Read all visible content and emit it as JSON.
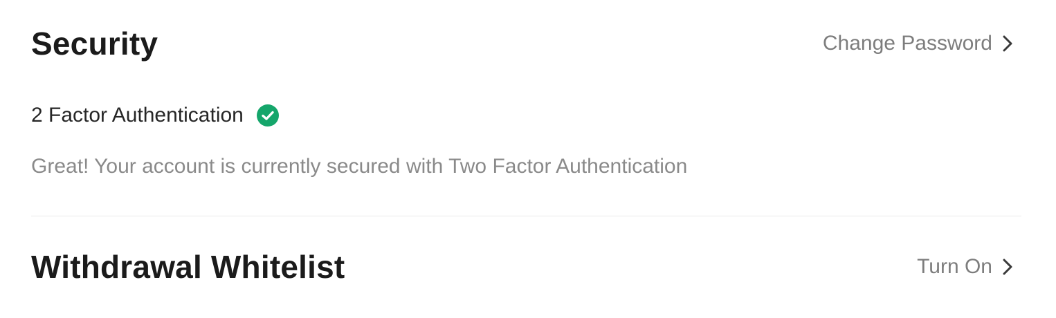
{
  "security": {
    "title": "Security",
    "change_password_label": "Change Password",
    "two_factor": {
      "label": "2 Factor Authentication",
      "status_icon": "check-circle-icon",
      "status_color": "#15a66b",
      "description": "Great! Your account is currently secured with Two Factor Authentication"
    }
  },
  "whitelist": {
    "title": "Withdrawal Whitelist",
    "action_label": "Turn On"
  },
  "colors": {
    "title": "#1b1b1b",
    "action": "#7d7d7d",
    "description": "#8a8a8a",
    "divider": "#e8e8e8",
    "success": "#15a66b"
  }
}
